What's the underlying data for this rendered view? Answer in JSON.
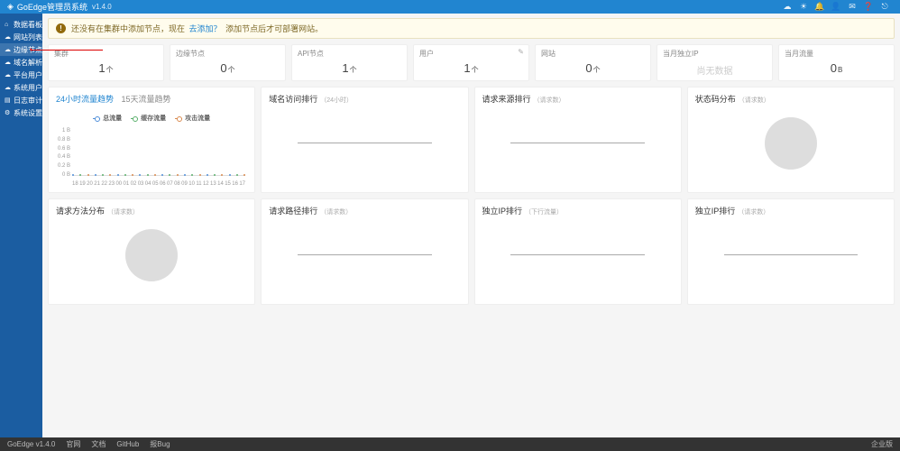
{
  "app": {
    "name": "GoEdge管理员系统",
    "version": "v1.4.0"
  },
  "topbar_icons": [
    "cloud-icon",
    "sun-icon",
    "bell-icon",
    "user-icon",
    "mail-icon",
    "help-icon",
    "logout-icon"
  ],
  "sidebar": [
    {
      "icon": "⌂",
      "label": "数据看板",
      "name": "dashboard"
    },
    {
      "icon": "☁",
      "label": "网站列表",
      "name": "sites"
    },
    {
      "icon": "☁",
      "label": "边缘节点",
      "name": "edge-nodes",
      "active": true
    },
    {
      "icon": "☁",
      "label": "域名解析",
      "name": "dns"
    },
    {
      "icon": "☁",
      "label": "平台用户",
      "name": "users"
    },
    {
      "icon": "☁",
      "label": "系统用户",
      "name": "admins"
    },
    {
      "icon": "▤",
      "label": "日志审计",
      "name": "logs"
    },
    {
      "icon": "⚙",
      "label": "系统设置",
      "name": "settings"
    }
  ],
  "alert": {
    "t1": "还没有在集群中添加节点，现在",
    "link": "去添加？",
    "t2": "添加节点后才可部署网站。"
  },
  "stats": [
    {
      "label": "集群",
      "value": "1",
      "unit": "个"
    },
    {
      "label": "边缘节点",
      "value": "0",
      "unit": "个"
    },
    {
      "label": "API节点",
      "value": "1",
      "unit": "个"
    },
    {
      "label": "用户",
      "value": "1",
      "unit": "个",
      "edit": true
    },
    {
      "label": "网站",
      "value": "0",
      "unit": "个"
    },
    {
      "label": "当月独立IP",
      "value": "尚无数据",
      "noval": true
    },
    {
      "label": "当月流量",
      "value": "0",
      "unit": "B"
    }
  ],
  "panels1": {
    "traffic": {
      "tab1": "24小时流量趋势",
      "tab2": "15天流量趋势",
      "legend": [
        "总流量",
        "缓存流量",
        "攻击流量"
      ],
      "y": [
        "1 B",
        "0.8 B",
        "0.6 B",
        "0.4 B",
        "0.2 B",
        "0 B"
      ],
      "x": [
        "18",
        "19",
        "20",
        "21",
        "22",
        "23",
        "00",
        "01",
        "02",
        "03",
        "04",
        "05",
        "06",
        "07",
        "08",
        "09",
        "10",
        "11",
        "12",
        "13",
        "14",
        "15",
        "16",
        "17"
      ]
    },
    "domain": {
      "title": "域名访问排行",
      "sub": "（24小时）"
    },
    "origin": {
      "title": "请求来源排行",
      "sub": "（请求数）"
    },
    "status": {
      "title": "状态码分布",
      "sub": "（请求数）"
    }
  },
  "panels2": {
    "method": {
      "title": "请求方法分布",
      "sub": "（请求数）"
    },
    "path": {
      "title": "请求路径排行",
      "sub": "（请求数）"
    },
    "ip": {
      "title": "独立IP排行",
      "sub": "（下行流量）"
    },
    "ip2": {
      "title": "独立IP排行",
      "sub": "（请求数）"
    }
  },
  "chart_data": {
    "type": "line",
    "x": [
      "18",
      "19",
      "20",
      "21",
      "22",
      "23",
      "00",
      "01",
      "02",
      "03",
      "04",
      "05",
      "06",
      "07",
      "08",
      "09",
      "10",
      "11",
      "12",
      "13",
      "14",
      "15",
      "16",
      "17"
    ],
    "series": [
      {
        "name": "总流量",
        "values": [
          0,
          0,
          0,
          0,
          0,
          0,
          0,
          0,
          0,
          0,
          0,
          0,
          0,
          0,
          0,
          0,
          0,
          0,
          0,
          0,
          0,
          0,
          0,
          0
        ]
      },
      {
        "name": "缓存流量",
        "values": [
          0,
          0,
          0,
          0,
          0,
          0,
          0,
          0,
          0,
          0,
          0,
          0,
          0,
          0,
          0,
          0,
          0,
          0,
          0,
          0,
          0,
          0,
          0,
          0
        ]
      },
      {
        "name": "攻击流量",
        "values": [
          0,
          0,
          0,
          0,
          0,
          0,
          0,
          0,
          0,
          0,
          0,
          0,
          0,
          0,
          0,
          0,
          0,
          0,
          0,
          0,
          0,
          0,
          0,
          0
        ]
      }
    ],
    "ylim": [
      0,
      1
    ],
    "yunit": "B",
    "title": "24小时流量趋势"
  },
  "footer": {
    "version": "GoEdge v1.4.0",
    "links": [
      "官网",
      "文档",
      "GitHub",
      "报Bug"
    ],
    "edition": "企业版"
  }
}
